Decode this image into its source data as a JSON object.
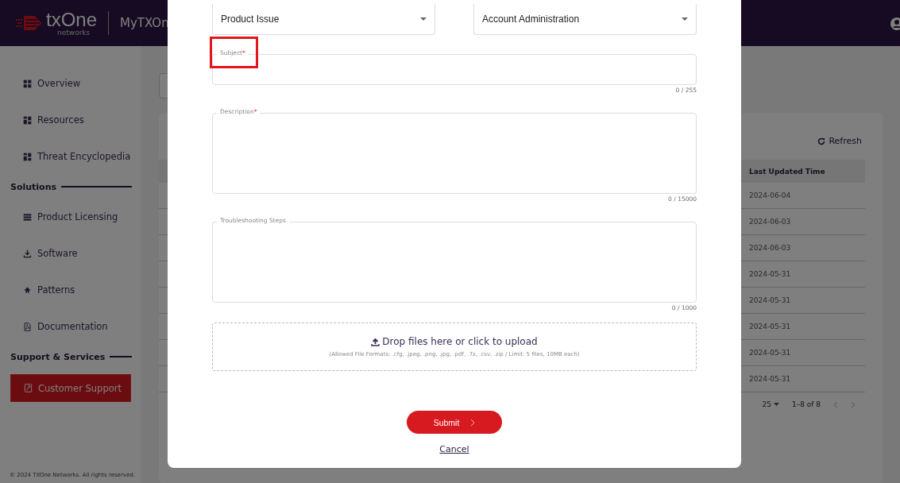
{
  "header": {
    "logo_text": "txOne",
    "logo_subtext": "networks",
    "app_name": "MyTXOn"
  },
  "sidebar": {
    "items": [
      {
        "kind": "item",
        "label": "Overview",
        "selected": false
      },
      {
        "kind": "item",
        "label": "Resources",
        "selected": false
      },
      {
        "kind": "item",
        "label": "Threat Encyclopedia",
        "selected": false
      },
      {
        "kind": "heading",
        "label": "Solutions"
      },
      {
        "kind": "item",
        "label": "Product Licensing",
        "selected": false
      },
      {
        "kind": "item",
        "label": "Software",
        "selected": false
      },
      {
        "kind": "item",
        "label": "Patterns",
        "selected": false
      },
      {
        "kind": "item",
        "label": "Documentation",
        "selected": false
      },
      {
        "kind": "heading",
        "label": "Support & Services"
      },
      {
        "kind": "item",
        "label": "Customer Support",
        "selected": true
      }
    ],
    "footer": "© 2024 TXOne Networks. All rights reserved."
  },
  "main": {
    "refresh": "Refresh",
    "table": {
      "columns": [
        "Last Updated Time"
      ],
      "rows": [
        [
          "2024-06-04"
        ],
        [
          "2024-06-03"
        ],
        [
          "2024-06-03"
        ],
        [
          "2024-05-31"
        ],
        [
          "2024-05-31"
        ],
        [
          "2024-05-31"
        ],
        [
          "2024-05-31"
        ],
        [
          "2024-05-31"
        ]
      ]
    },
    "pagination": {
      "rows_per_page": "25",
      "range": "1–8 of 8"
    }
  },
  "modal": {
    "selects": [
      {
        "value": "Product Issue"
      },
      {
        "value": "Account Administration"
      }
    ],
    "fields": [
      {
        "kind": "input",
        "label": "Subject",
        "mark": "*",
        "counter": "0 / 255",
        "highlighted": true
      },
      {
        "kind": "textarea",
        "label": "Description",
        "mark": "*",
        "counter": "0 / 15000",
        "highlighted": false
      },
      {
        "kind": "textarea",
        "label": "Troubleshooting Steps",
        "counter": "0 / 1000",
        "highlighted": false
      }
    ],
    "upload": {
      "title": "Drop files here or click to upload",
      "hint": "(Allowed File Formats: .cfg, .jpeg, .png, .jpg, .pdf, .7z, .csv, .zip / Limit: 5 files, 10MB each)"
    },
    "submit": "Submit",
    "cancel": "Cancel"
  }
}
